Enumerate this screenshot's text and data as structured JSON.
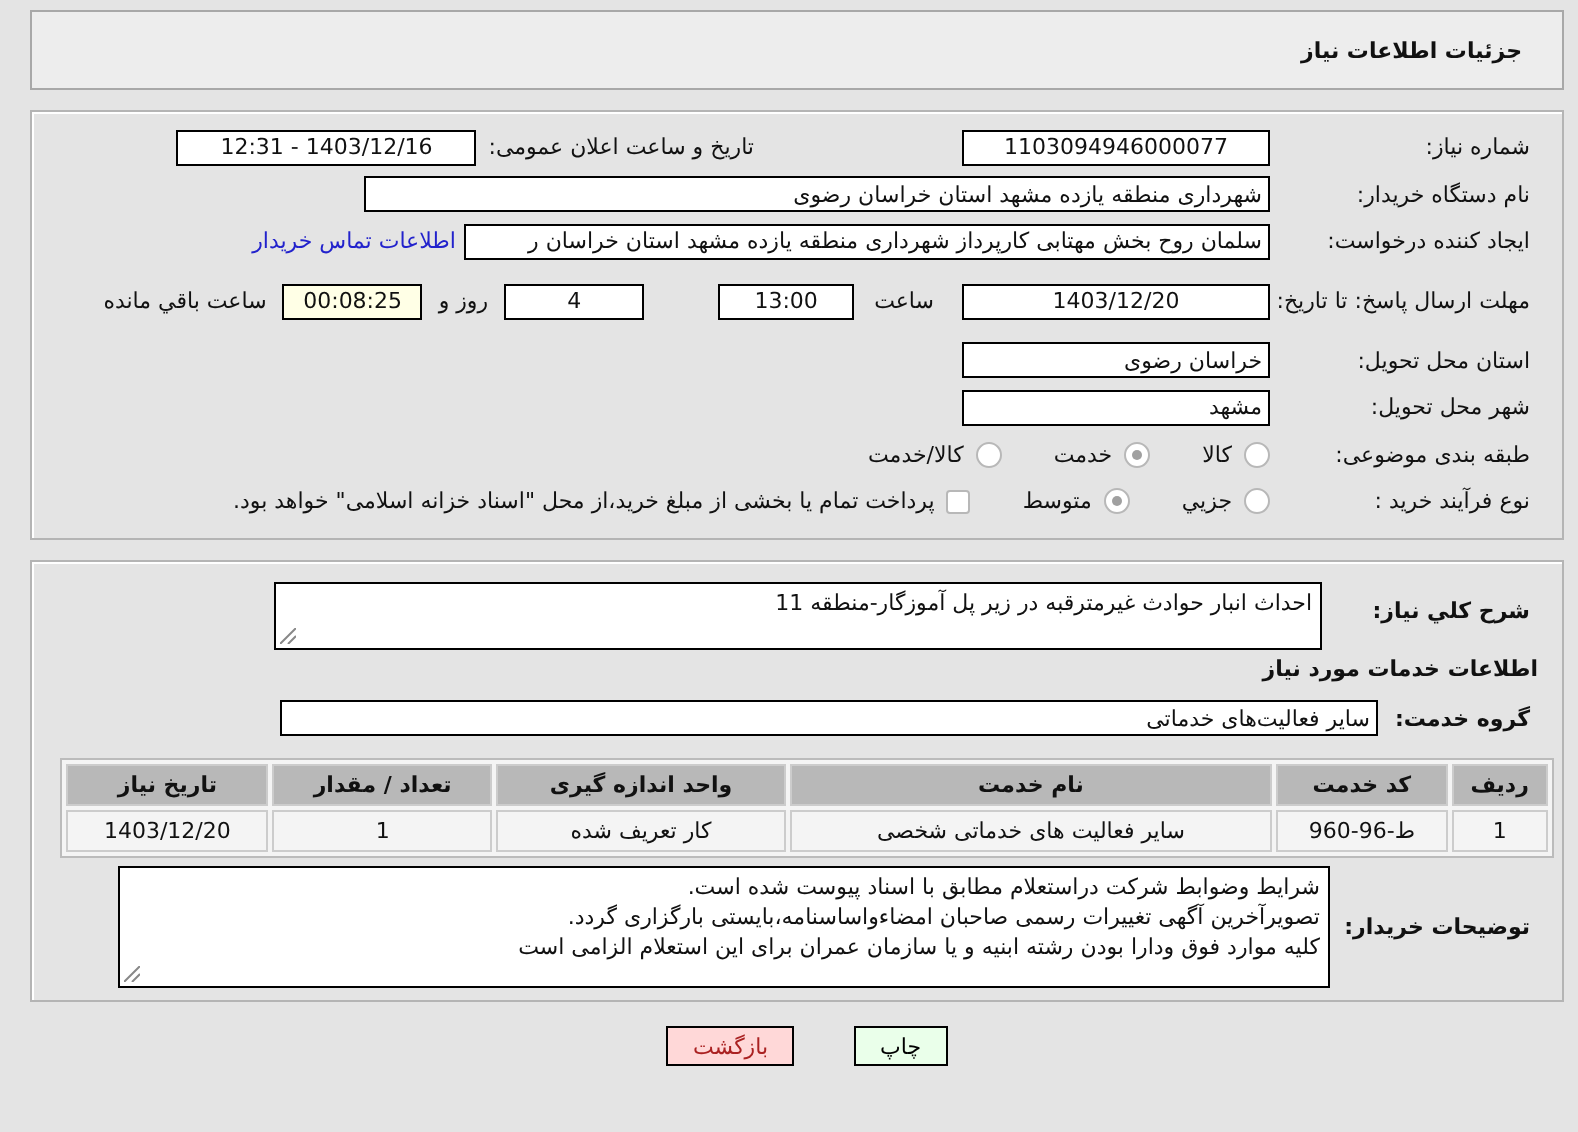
{
  "header": {
    "title": "جزئیات اطلاعات نیاز"
  },
  "details": {
    "need_number": {
      "label": "شماره نیاز:",
      "value": "1103094946000077"
    },
    "announcement": {
      "label": "تاریخ و ساعت اعلان عمومی:",
      "value": "1403/12/16 - 12:31"
    },
    "buyer_org": {
      "label": "نام دستگاه خریدار:",
      "value": "شهرداری منطقه یازده مشهد استان خراسان رضوی"
    },
    "requester": {
      "label": "ایجاد کننده درخواست:",
      "value": "سلمان روح بخش مهتابی کارپرداز شهرداری منطقه یازده مشهد استان خراسان ر",
      "link": "اطلاعات تماس خریدار"
    },
    "deadline": {
      "label": "مهلت ارسال پاسخ: تا تاریخ:",
      "date": "1403/12/20",
      "time_label": "ساعت",
      "time": "13:00",
      "days": "4",
      "days_label": "روز و",
      "remaining": "00:08:25",
      "remaining_label": "ساعت باقي مانده"
    },
    "province": {
      "label": "استان محل تحویل:",
      "value": "خراسان رضوی"
    },
    "city": {
      "label": "شهر محل تحویل:",
      "value": "مشهد"
    },
    "category": {
      "label": "طبقه بندی موضوعی:",
      "options": [
        {
          "label": "کالا",
          "selected": false
        },
        {
          "label": "خدمت",
          "selected": true
        },
        {
          "label": "کالا/خدمت",
          "selected": false
        }
      ]
    },
    "process": {
      "label": "نوع فرآیند خرید :",
      "options": [
        {
          "label": "جزیي",
          "selected": false
        },
        {
          "label": "متوسط",
          "selected": true
        }
      ],
      "treasury": {
        "checked": false,
        "label": "پرداخت تمام یا بخشی از مبلغ خرید،از محل \"اسناد خزانه اسلامی\" خواهد بود."
      }
    }
  },
  "needs": {
    "summary": {
      "label": "شرح کلي نیاز:",
      "value": "احداث انبار حوادث غیرمترقبه در زیر پل آموزگار-منطقه 11"
    },
    "section_title": "اطلاعات خدمات مورد نیاز",
    "service_group": {
      "label": "گروه خدمت:",
      "value": "سایر فعالیت‌های خدماتی"
    },
    "table": {
      "columns": [
        "ردیف",
        "کد خدمت",
        "نام خدمت",
        "واحد اندازه گیری",
        "تعداد / مقدار",
        "تاریخ نیاز"
      ],
      "rows": [
        [
          "1",
          "ط-96-960",
          "سایر فعالیت های خدماتی شخصی",
          "کار تعریف شده",
          "1",
          "1403/12/20"
        ]
      ]
    },
    "buyer_notes": {
      "label": "توضیحات خریدار:",
      "lines": [
        "شرایط وضوابط شرکت دراستعلام مطابق با اسناد پیوست شده است.",
        "تصویرآخرین آگهی تغییرات رسمی صاحبان امضاءواساسنامه،بایستی بارگزاری گردد.",
        "کلیه موارد فوق ودارا بودن رشته ابنیه و یا سازمان عمران برای این استعلام الزامی است"
      ]
    }
  },
  "buttons": [
    {
      "label": "چاپ",
      "kind": "print"
    },
    {
      "label": "بازگشت",
      "kind": "back"
    }
  ]
}
